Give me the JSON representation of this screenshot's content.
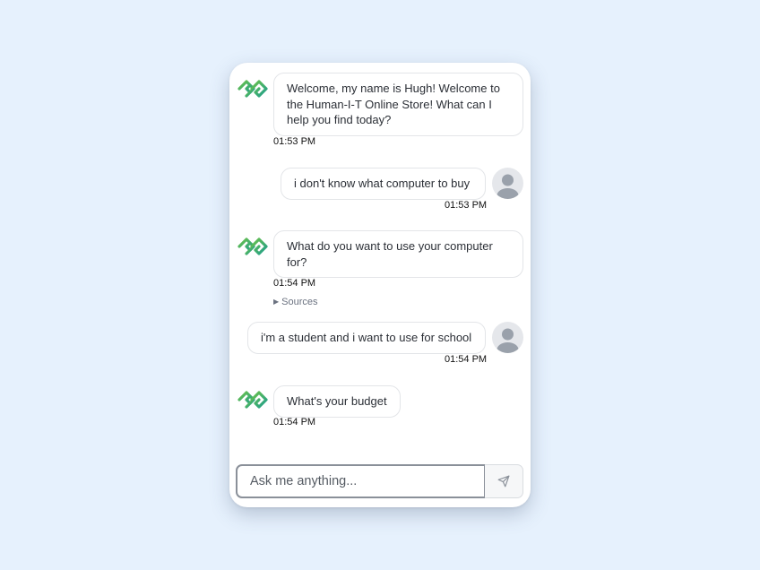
{
  "messages": [
    {
      "sender": "bot",
      "text": "Welcome, my name is Hugh! Welcome to the Human-I-T Online Store! What can I help you find today?",
      "time": "01:53 PM"
    },
    {
      "sender": "user",
      "text": "i don't know what computer to buy",
      "time": "01:53 PM"
    },
    {
      "sender": "bot",
      "text": "What do you want to use your computer for?",
      "time": "01:54 PM",
      "sources_label": "Sources"
    },
    {
      "sender": "user",
      "text": "i'm a student and i want to use for school",
      "time": "01:54 PM"
    },
    {
      "sender": "bot",
      "text": "What's your budget",
      "time": "01:54 PM"
    }
  ],
  "input": {
    "placeholder": "Ask me anything...",
    "value": ""
  },
  "icons": {
    "bot_avatar": "human-i-t-logo-icon",
    "user_avatar": "user-silhouette-icon",
    "send": "paper-plane-icon",
    "sources_toggle": "triangle-right-icon"
  },
  "colors": {
    "background": "#e6f1fd",
    "logo_green": "#3bb54a",
    "logo_teal": "#1e9e8c",
    "input_border": "#8a9099"
  }
}
